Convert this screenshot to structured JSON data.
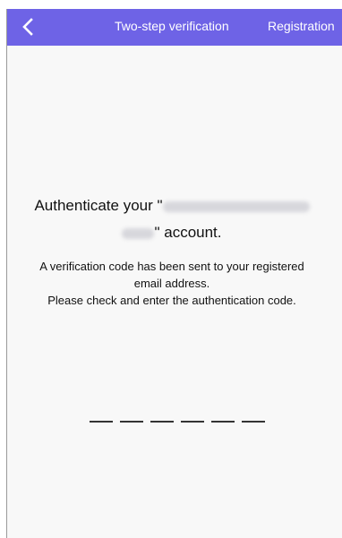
{
  "header": {
    "back_icon": "chevron-left-icon",
    "title": "Two-step verification",
    "registration_link": "Registration",
    "bg_color": "#6e63e6"
  },
  "main": {
    "auth_prefix": "Authenticate your \"",
    "auth_suffix": "\" account.",
    "info_line1": "A verification code has been sent to your registered",
    "info_line2": "email address.",
    "info_line3": "Please check and enter the authentication code.",
    "code_digit_count": 6
  }
}
